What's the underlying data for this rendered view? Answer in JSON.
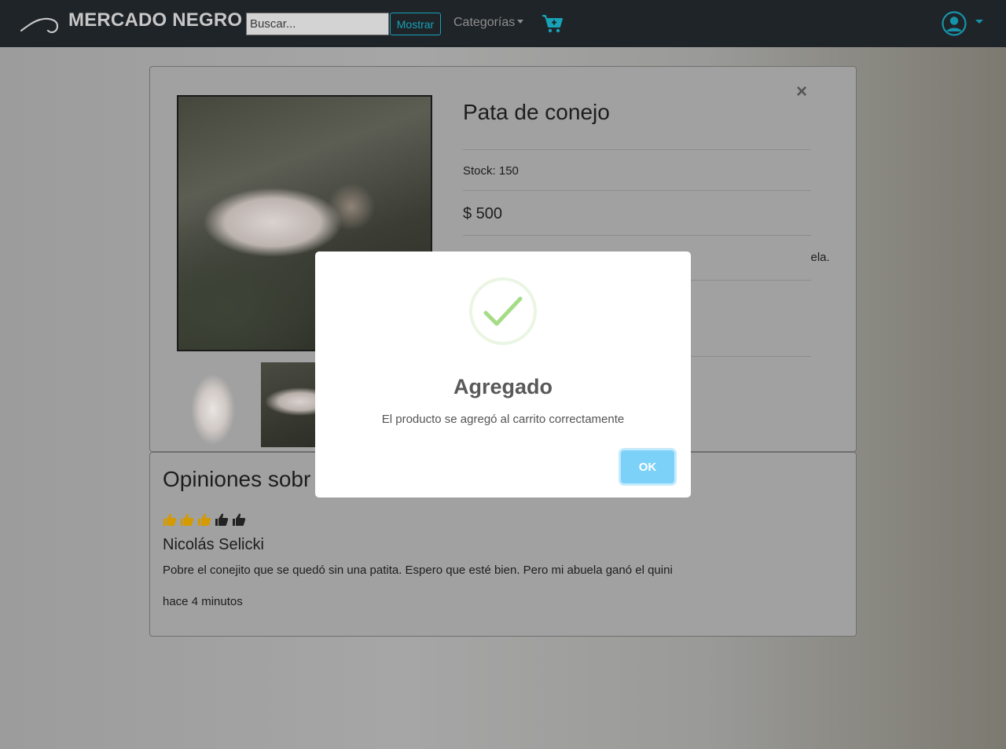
{
  "navbar": {
    "brand": "MERCADO NEGRO",
    "search_placeholder": "Buscar...",
    "search_button": "Mostrar",
    "categories_label": "Categorías",
    "accent_color": "#17a2b8"
  },
  "product": {
    "title": "Pata de conejo",
    "stock": "Stock: 150",
    "price": "$ 500",
    "description_partial": "ela."
  },
  "reviews": {
    "title": "Opiniones sobr",
    "rating": {
      "value": 3,
      "max": 5
    },
    "items": [
      {
        "author": "Nicolás Selicki",
        "text": "Pobre el conejito que se quedó sin una patita. Espero que esté bien. Pero mi abuela ganó el quini",
        "time": "hace 4 minutos"
      }
    ]
  },
  "modal": {
    "title": "Agregado",
    "text": "El producto se agregó al carrito correctamente",
    "ok_label": "OK",
    "success_color": "#a5dc86",
    "button_color": "#7cd1f9"
  },
  "icons": {
    "logo": "hook-logo-icon",
    "cart": "cart-plus-icon",
    "user": "user-circle-icon",
    "close": "close-icon",
    "success": "checkmark-icon",
    "rating": "thumbs-up-icon"
  }
}
